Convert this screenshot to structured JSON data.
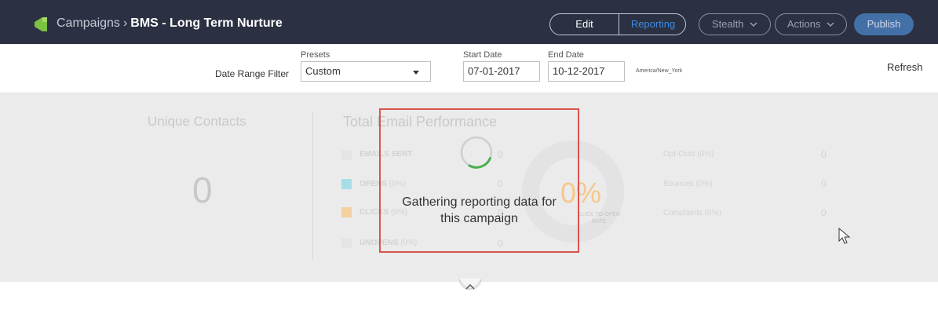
{
  "header": {
    "breadcrumb_root": "Campaigns",
    "breadcrumb_sep": "›",
    "campaign_name": "BMS - Long Term Nurture",
    "edit_label": "Edit",
    "reporting_label": "Reporting",
    "stealth_label": "Stealth",
    "actions_label": "Actions",
    "publish_label": "Publish"
  },
  "filters": {
    "date_range_label": "Date Range Filter",
    "presets_label": "Presets",
    "presets_value": "Custom",
    "start_label": "Start Date",
    "start_value": "07-01-2017",
    "end_label": "End Date",
    "end_value": "10-12-2017",
    "timezone": "America/New_York",
    "refresh_label": "Refresh"
  },
  "unique_contacts": {
    "title": "Unique Contacts",
    "value": "0"
  },
  "email_performance": {
    "title": "Total Email Performance",
    "metrics": [
      {
        "label": "EMAILS SENT",
        "pct": "",
        "value": "0",
        "color": "#e5e5e5"
      },
      {
        "label": "OPENS",
        "pct": " (0%)",
        "value": "0",
        "color": "#a8dde8"
      },
      {
        "label": "CLICKS",
        "pct": " (0%)",
        "value": "0",
        "color": "#f5cfa0"
      },
      {
        "label": "UNOPENS",
        "pct": " (0%)",
        "value": "0",
        "color": "#e5e5e5"
      }
    ],
    "click_to_open_pct": "0%",
    "click_to_open_label": "CLICK TO OPEN RATE",
    "side_stats": [
      {
        "label": "Opt-Outs (0%)",
        "value": "0"
      },
      {
        "label": "Bounces (0%)",
        "value": "0"
      },
      {
        "label": "Complaints (0%)",
        "value": "0"
      }
    ]
  },
  "loading": {
    "line1": "Gathering reporting data for",
    "line2": "this campaign"
  },
  "colors": {
    "topbar": "#2b3142",
    "accent": "#3b8be0",
    "publish": "#4470a8",
    "highlight_box": "#d9534f",
    "spinner": "#4caf50"
  },
  "icons": [
    "campaign-logo-icon",
    "chevron-down-icon",
    "spinner-icon",
    "chevron-up-icon",
    "mouse-cursor-icon"
  ]
}
